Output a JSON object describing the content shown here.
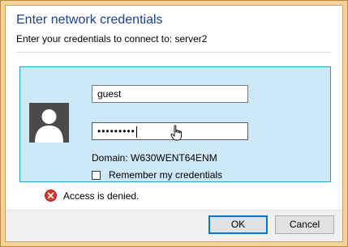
{
  "dialog": {
    "title": "Enter network credentials",
    "subtitle": "Enter your credentials to connect to: server2"
  },
  "credentials": {
    "username_value": "guest",
    "password_masked": "•••••••••",
    "domain_text": "Domain: W630WENT64ENM",
    "remember_label": "Remember my credentials",
    "remember_checked": false
  },
  "error": {
    "message": "Access is denied."
  },
  "buttons": {
    "ok_label": "OK",
    "cancel_label": "Cancel"
  },
  "colors": {
    "title": "#1c3f94",
    "tile_background": "#cde8f6",
    "tile_border": "#26a0da",
    "frame": "#f4d39a",
    "error_icon": "#d9362c"
  }
}
